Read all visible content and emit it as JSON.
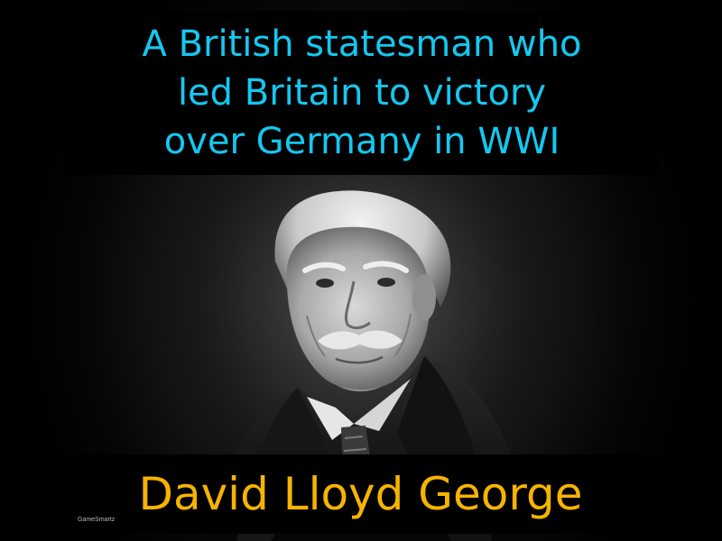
{
  "definition": {
    "text": "A British statesman who\nled Britain to victory\nover Germany in WWI",
    "color": "#14c8f0"
  },
  "term": {
    "text": "David Lloyd George",
    "color": "#f6b400"
  },
  "brand": {
    "text": "GameSmartz"
  },
  "portrait": {
    "style": "black-and-white photograph",
    "subject": "elderly man with white hair and moustache in dark suit"
  }
}
